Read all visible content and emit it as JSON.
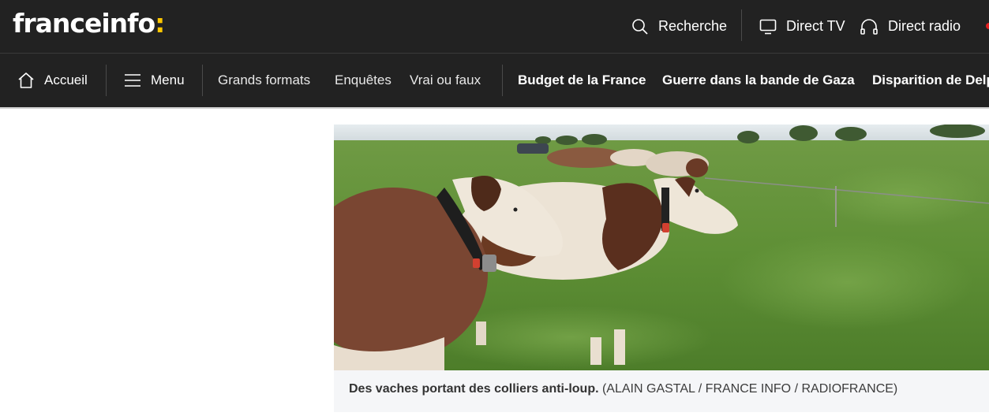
{
  "header": {
    "logo_text": "franceinfo",
    "logo_colon": ":",
    "search_label": "Recherche",
    "direct_tv_label": "Direct TV",
    "direct_radio_label": "Direct radio"
  },
  "nav": {
    "home_label": "Accueil",
    "menu_label": "Menu",
    "links": [
      "Grands formats",
      "Enquêtes",
      "Vrai ou faux"
    ],
    "topics": [
      "Budget de la France",
      "Guerre dans la bande de Gaza",
      "Disparition de Delp"
    ]
  },
  "figure": {
    "caption_main": "Des vaches portant des colliers anti-loup.",
    "caption_credit": " (ALAIN GASTAL / FRANCE INFO / RADIOFRANCE)"
  },
  "colors": {
    "header_bg": "#222222",
    "logo_accent": "#ffc700",
    "live_red": "#e02020"
  },
  "icons": {
    "search": "search-icon",
    "tv": "tv-icon",
    "radio": "headphones-icon",
    "home": "home-icon",
    "menu": "hamburger-icon"
  }
}
